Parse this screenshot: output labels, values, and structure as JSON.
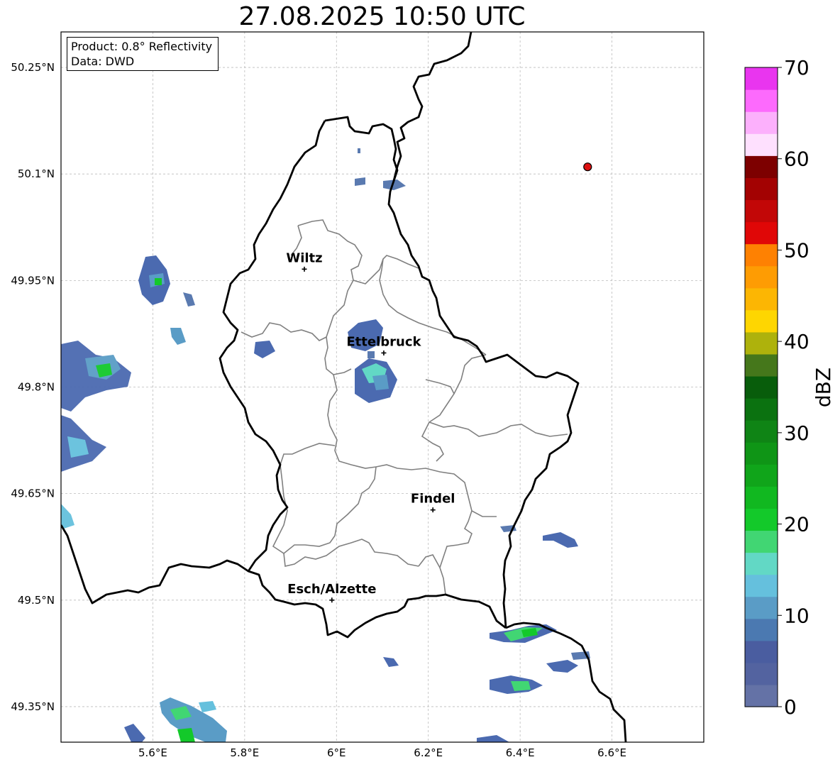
{
  "title": "27.08.2025 10:50 UTC",
  "info": {
    "product": "Product: 0.8° Reflectivity",
    "data": "Data: DWD"
  },
  "map": {
    "lon_range": [
      5.4,
      6.8
    ],
    "lat_range": [
      49.3,
      50.3
    ],
    "lat_ticks": [
      {
        "value": 50.25,
        "label": "50.25°N"
      },
      {
        "value": 50.1,
        "label": "50.1°N"
      },
      {
        "value": 49.95,
        "label": "49.95°N"
      },
      {
        "value": 49.8,
        "label": "49.8°N"
      },
      {
        "value": 49.65,
        "label": "49.65°N"
      },
      {
        "value": 49.5,
        "label": "49.5°N"
      },
      {
        "value": 49.35,
        "label": "49.35°N"
      }
    ],
    "lon_ticks": [
      {
        "value": 5.6,
        "label": "5.6°E"
      },
      {
        "value": 5.8,
        "label": "5.8°E"
      },
      {
        "value": 6.0,
        "label": "6°E"
      },
      {
        "value": 6.2,
        "label": "6.2°E"
      },
      {
        "value": 6.4,
        "label": "6.4°E"
      },
      {
        "value": 6.6,
        "label": "6.6°E"
      }
    ],
    "cities": [
      {
        "name": "Wiltz",
        "lon": 5.93,
        "lat": 49.966
      },
      {
        "name": "Ettelbruck",
        "lon": 6.103,
        "lat": 49.848
      },
      {
        "name": "Findel",
        "lon": 6.21,
        "lat": 49.627
      },
      {
        "name": "Esch/Alzette",
        "lon": 5.99,
        "lat": 49.5
      }
    ],
    "radar_site": {
      "lon": 6.547,
      "lat": 50.11,
      "color": "#dd1111"
    },
    "grid": true
  },
  "colorbar": {
    "label": "dBZ",
    "min": 0,
    "max": 70,
    "ticks": [
      "0",
      "10",
      "20",
      "30",
      "40",
      "50",
      "60",
      "70"
    ],
    "colors": [
      "#6472a6",
      "#5363a0",
      "#4a5da0",
      "#4b79b1",
      "#5a9cc6",
      "#65c0dd",
      "#62d8c5",
      "#41d673",
      "#13c92a",
      "#11b820",
      "#10a51a",
      "#0f9516",
      "#0f8415",
      "#0b7210",
      "#085d0b",
      "#45771b",
      "#aeb20c",
      "#fed601",
      "#fcb603",
      "#fe9c03",
      "#fe8102",
      "#e00707",
      "#c20707",
      "#a30202",
      "#7d0000",
      "#fee0fe",
      "#fcb0fc",
      "#fd6afd",
      "#e935ef"
    ]
  }
}
